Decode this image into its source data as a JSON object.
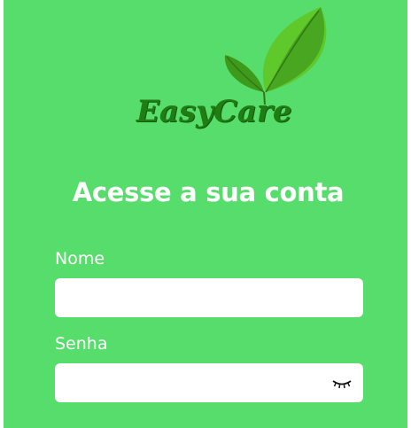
{
  "brand": {
    "name": "EasyCare",
    "leaf_icon": "leaf-icon",
    "colors": {
      "leaf_light": "#5fc92b",
      "leaf_dark": "#3e9a1b",
      "text": "#1f7d14"
    }
  },
  "colors": {
    "background": "#57dd6b",
    "input_background": "#ffffff",
    "text": "#ffffff"
  },
  "login": {
    "title": "Acesse a sua conta",
    "name_label": "Nome",
    "name_value": "",
    "password_label": "Senha",
    "password_value": "",
    "password_toggle_icon": "eye-closed-icon"
  }
}
